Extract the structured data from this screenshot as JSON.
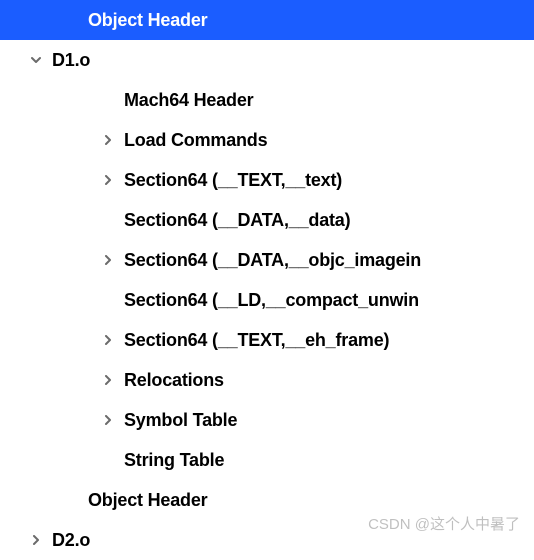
{
  "tree": {
    "items": [
      {
        "label": "Object Header",
        "indent": 2,
        "arrow": "none",
        "selected": true
      },
      {
        "label": "D1.o",
        "indent": 1,
        "arrow": "down",
        "selected": false
      },
      {
        "label": "Mach64 Header",
        "indent": 3,
        "arrow": "none",
        "selected": false
      },
      {
        "label": "Load Commands",
        "indent": 3,
        "arrow": "right",
        "selected": false
      },
      {
        "label": "Section64 (__TEXT,__text)",
        "indent": 3,
        "arrow": "right",
        "selected": false
      },
      {
        "label": "Section64 (__DATA,__data)",
        "indent": 3,
        "arrow": "none",
        "selected": false
      },
      {
        "label": "Section64 (__DATA,__objc_imagein",
        "indent": 3,
        "arrow": "right",
        "selected": false
      },
      {
        "label": "Section64 (__LD,__compact_unwin",
        "indent": 3,
        "arrow": "none",
        "selected": false
      },
      {
        "label": "Section64 (__TEXT,__eh_frame)",
        "indent": 3,
        "arrow": "right",
        "selected": false
      },
      {
        "label": "Relocations",
        "indent": 3,
        "arrow": "right",
        "selected": false
      },
      {
        "label": "Symbol Table",
        "indent": 3,
        "arrow": "right",
        "selected": false
      },
      {
        "label": "String Table",
        "indent": 3,
        "arrow": "none",
        "selected": false
      },
      {
        "label": "Object Header",
        "indent": 2,
        "arrow": "none",
        "selected": false
      },
      {
        "label": "D2.o",
        "indent": 1,
        "arrow": "right",
        "selected": false
      }
    ]
  },
  "watermark": "CSDN @这个人中暑了"
}
